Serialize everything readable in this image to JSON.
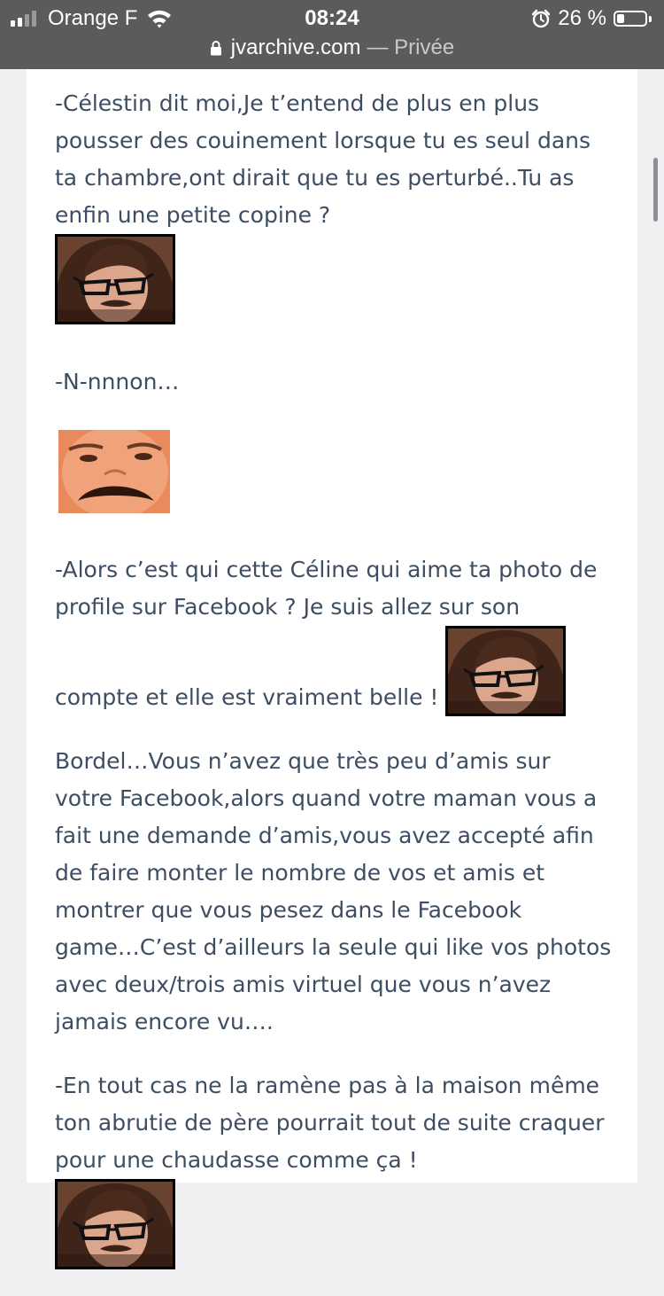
{
  "status_bar": {
    "carrier": "Orange F",
    "time": "08:24",
    "battery_percent": "26 %",
    "battery_level": 0.26
  },
  "browser": {
    "url": "jvarchive.com",
    "separator": "—",
    "mode": "Privée"
  },
  "post": {
    "paragraph_1": "-Célestin dit moi,Je t’entend de plus en plus pousser des couinement lorsque tu es seul dans ta chambre,ont dirait que tu es perturbé..Tu as enfin une petite copine ?",
    "paragraph_2": "-N-nnnon…",
    "paragraph_3a": "-Alors c’est qui cette Céline qui aime ta photo de profile sur Facebook ? Je suis allez sur son",
    "paragraph_3b": "compte et elle est vraiment belle !",
    "paragraph_4": "Bordel…Vous n’avez que très peu d’amis sur votre Facebook,alors quand votre maman vous a fait une demande d’amis,vous avez accepté afin de faire monter le nombre de vos et amis et montrer que vous pesez dans le Facebook game…C’est d’ailleurs la seule qui like vos photos avec deux/trois amis virtuel que vous n’avez jamais encore vu….",
    "paragraph_5": "-En tout cas ne la ramène pas à la maison même ton abrutie de père pourrait tout de suite craquer pour une chaudasse comme ça !"
  },
  "icons": {
    "signal": "cellular-signal-icon",
    "wifi": "wifi-icon",
    "alarm": "alarm-icon",
    "battery": "battery-icon",
    "lock": "lock-icon"
  },
  "stickers": {
    "woman": "sticker-woman-glasses",
    "man": "sticker-man-mustache"
  },
  "colors": {
    "status_bar_bg": "#5b5b5b",
    "page_bg": "#f0f0f2",
    "card_bg": "#ffffff",
    "text": "#3d4e63",
    "muted": "#c9c9c9"
  }
}
